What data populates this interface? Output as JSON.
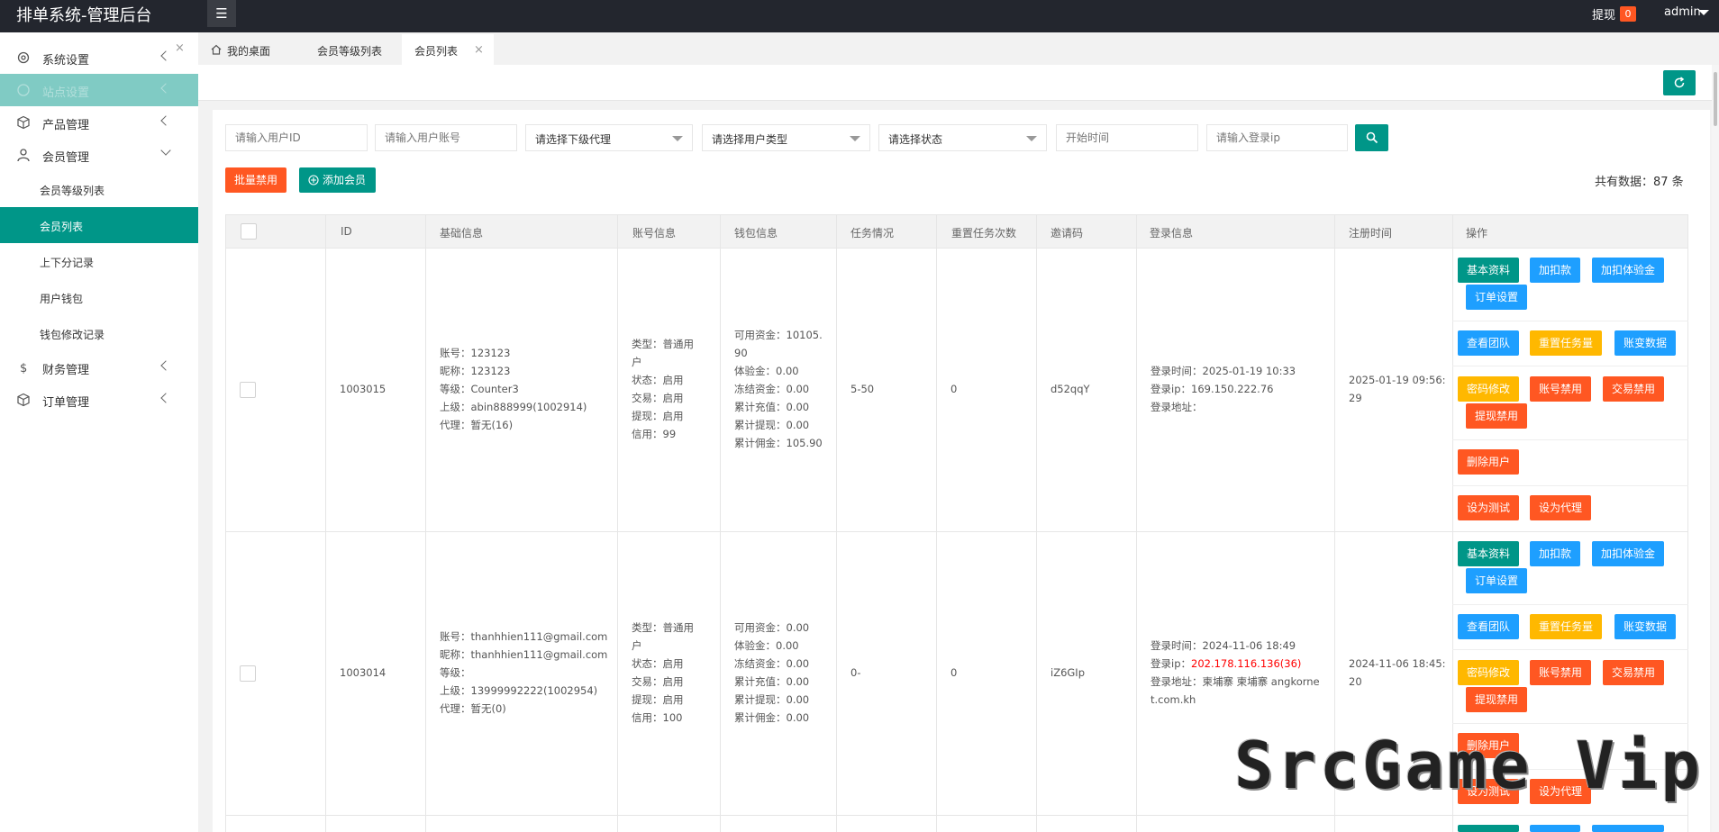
{
  "app": {
    "title": "排单系统-管理后台"
  },
  "header": {
    "withdraw_label": "提现",
    "withdraw_count": "0",
    "user": "admin"
  },
  "sidebar": {
    "items": [
      {
        "label": "系统设置",
        "icon": "gear-icon"
      },
      {
        "label": "站点设置",
        "icon": "globe-icon"
      },
      {
        "label": "产品管理",
        "icon": "cube-icon"
      },
      {
        "label": "会员管理",
        "icon": "user-icon"
      },
      {
        "label": "财务管理",
        "icon": "dollar-icon"
      },
      {
        "label": "订单管理",
        "icon": "box-icon"
      }
    ],
    "subitems": [
      "会员等级列表",
      "会员列表",
      "上下分记录",
      "用户钱包",
      "钱包修改记录"
    ]
  },
  "tabs": [
    {
      "label": "我的桌面"
    },
    {
      "label": "会员等级列表"
    },
    {
      "label": "会员列表"
    }
  ],
  "filters": {
    "user_id_placeholder": "请输入用户ID",
    "account_placeholder": "请输入用户账号",
    "agent_select": "请选择下级代理",
    "type_select": "请选择用户类型",
    "status_select": "请选择状态",
    "start_time_placeholder": "开始时间",
    "ip_placeholder": "请输入登录ip"
  },
  "actions": {
    "batch_disable": "批量禁用",
    "add_member": "添加会员",
    "total": "共有数据：87 条"
  },
  "table": {
    "headers": [
      "ID",
      "基础信息",
      "账号信息",
      "钱包信息",
      "任务情况",
      "重置任务次数",
      "邀请码",
      "登录信息",
      "注册时间",
      "操作"
    ],
    "rows": [
      {
        "id": "1003015",
        "basic": [
          "账号：123123",
          "昵称：123123",
          "等级：Counter3",
          "上级：abin888999(1002914)",
          "代理：暂无(16)"
        ],
        "account": [
          "类型：普通用",
          "户",
          "状态：启用",
          "交易：启用",
          "提现：启用",
          "信用：99"
        ],
        "wallet": [
          "可用资金：10105.",
          "90",
          "体验金：0.00",
          "冻结资金：0.00",
          "累计充值：0.00",
          "累计提现：0.00",
          "累计佣金：105.90"
        ],
        "task": "5-50",
        "reset": "0",
        "invite": "d52qqY",
        "login_time": "登录时间：2025-01-19 10:33",
        "login_ip_label": "登录ip：",
        "login_ip": "169.150.222.76",
        "login_addr": "登录地址：",
        "login_addr2": "",
        "reg": [
          "2025-01-19 09:56:",
          "29"
        ]
      },
      {
        "id": "1003014",
        "basic": [
          "账号：thanhhien111@gmail.com",
          "昵称：thanhhien111@gmail.com",
          "等级：",
          "上级：13999992222(1002954)",
          "代理：暂无(0)"
        ],
        "account": [
          "类型：普通用",
          "户",
          "状态：启用",
          "交易：启用",
          "提现：启用",
          "信用：100"
        ],
        "wallet": [
          "可用资金：0.00",
          "体验金：0.00",
          "冻结资金：0.00",
          "累计充值：0.00",
          "累计提现：0.00",
          "累计佣金：0.00"
        ],
        "task": "0-",
        "reset": "0",
        "invite": "iZ6GIp",
        "login_time": "登录时间：2024-11-06 18:49",
        "login_ip_label": "登录ip：",
        "login_ip": "202.178.116.136(36)",
        "login_addr": "登录地址：柬埔寨 柬埔寨 angkorne",
        "login_addr2": "t.com.kh",
        "reg": [
          "2024-11-06 18:45:",
          "20"
        ]
      }
    ],
    "ops": {
      "basic": "基本资料",
      "add_deduct": "加扣款",
      "add_exp": "加扣体验金",
      "order_set": "订单设置",
      "team": "查看团队",
      "reset_task": "重置任务量",
      "acct_data": "账变数据",
      "pwd": "密码修改",
      "acct_disable": "账号禁用",
      "trade_disable": "交易禁用",
      "withdraw_disable": "提现禁用",
      "delete": "删除用户",
      "set_test": "设为测试",
      "set_agent": "设为代理"
    }
  },
  "watermark": "SrcGame Vip",
  "colors": {
    "primary": "#009688",
    "blue": "#1e9fff",
    "orange": "#ff5722",
    "yellow": "#ffb800",
    "header": "#23262e"
  }
}
